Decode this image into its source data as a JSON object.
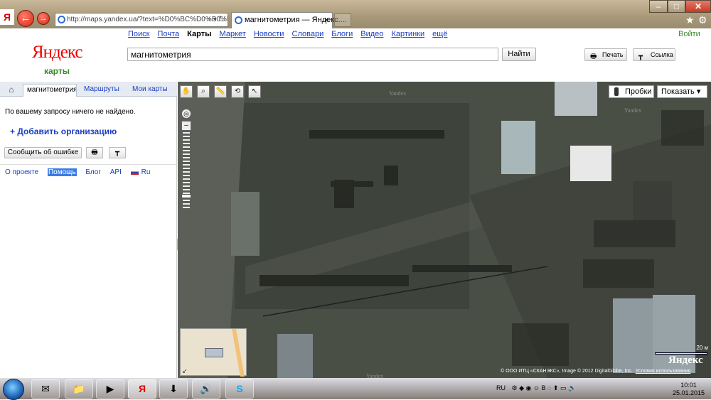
{
  "browser": {
    "address": "http://maps.yandex.ua/?text=%D0%BC%D0%B0%D0%B3%D0%BD%D0%B8",
    "address_display": "http://maps.yandex.ua/?text=%D0%BC%D0%B0%D0%B3%D0%BD%D0%B8",
    "tab_title": "магнитометрия — Яндекс....",
    "tab_close": "×",
    "minimize": "–",
    "maximize": "□",
    "close": "✕"
  },
  "header": {
    "nav": [
      "Поиск",
      "Почта",
      "Карты",
      "Маркет",
      "Новости",
      "Словари",
      "Блоги",
      "Видео",
      "Картинки",
      "ещё"
    ],
    "login": "Войти",
    "logo": "Яндекс",
    "logo_sub": "карты",
    "search_value": "магнитометрия",
    "find_label": "Найти",
    "print_label": "Печать",
    "link_label": "Ссылка"
  },
  "sidebar": {
    "tabs": [
      "магнитометрия",
      "Маршруты",
      "Мои карты"
    ],
    "not_found": "По вашему запросу ничего не найдено.",
    "add_org": "+ Добавить организацию",
    "report_error": "Сообщить об ошибке",
    "footer": [
      "О проекте",
      "Помощь",
      "Блог",
      "API",
      "Ru"
    ]
  },
  "map": {
    "traffic_label": "Пробки",
    "show_label": "Показать ▾",
    "watermark": "Yandex",
    "scale_label": "20 м",
    "logo": "Яндекс",
    "copyright": "© ООО ИТЦ «СКАНЭКС», Image © 2012 DigitalGlobe, Inc.",
    "terms": "Условия использования"
  },
  "taskbar": {
    "lang": "RU",
    "time": "10:01",
    "date": "25.01.2015"
  },
  "colors": {
    "link": "#1a3dc1",
    "green": "#3a8a2a",
    "logo_red": "#e00000"
  }
}
